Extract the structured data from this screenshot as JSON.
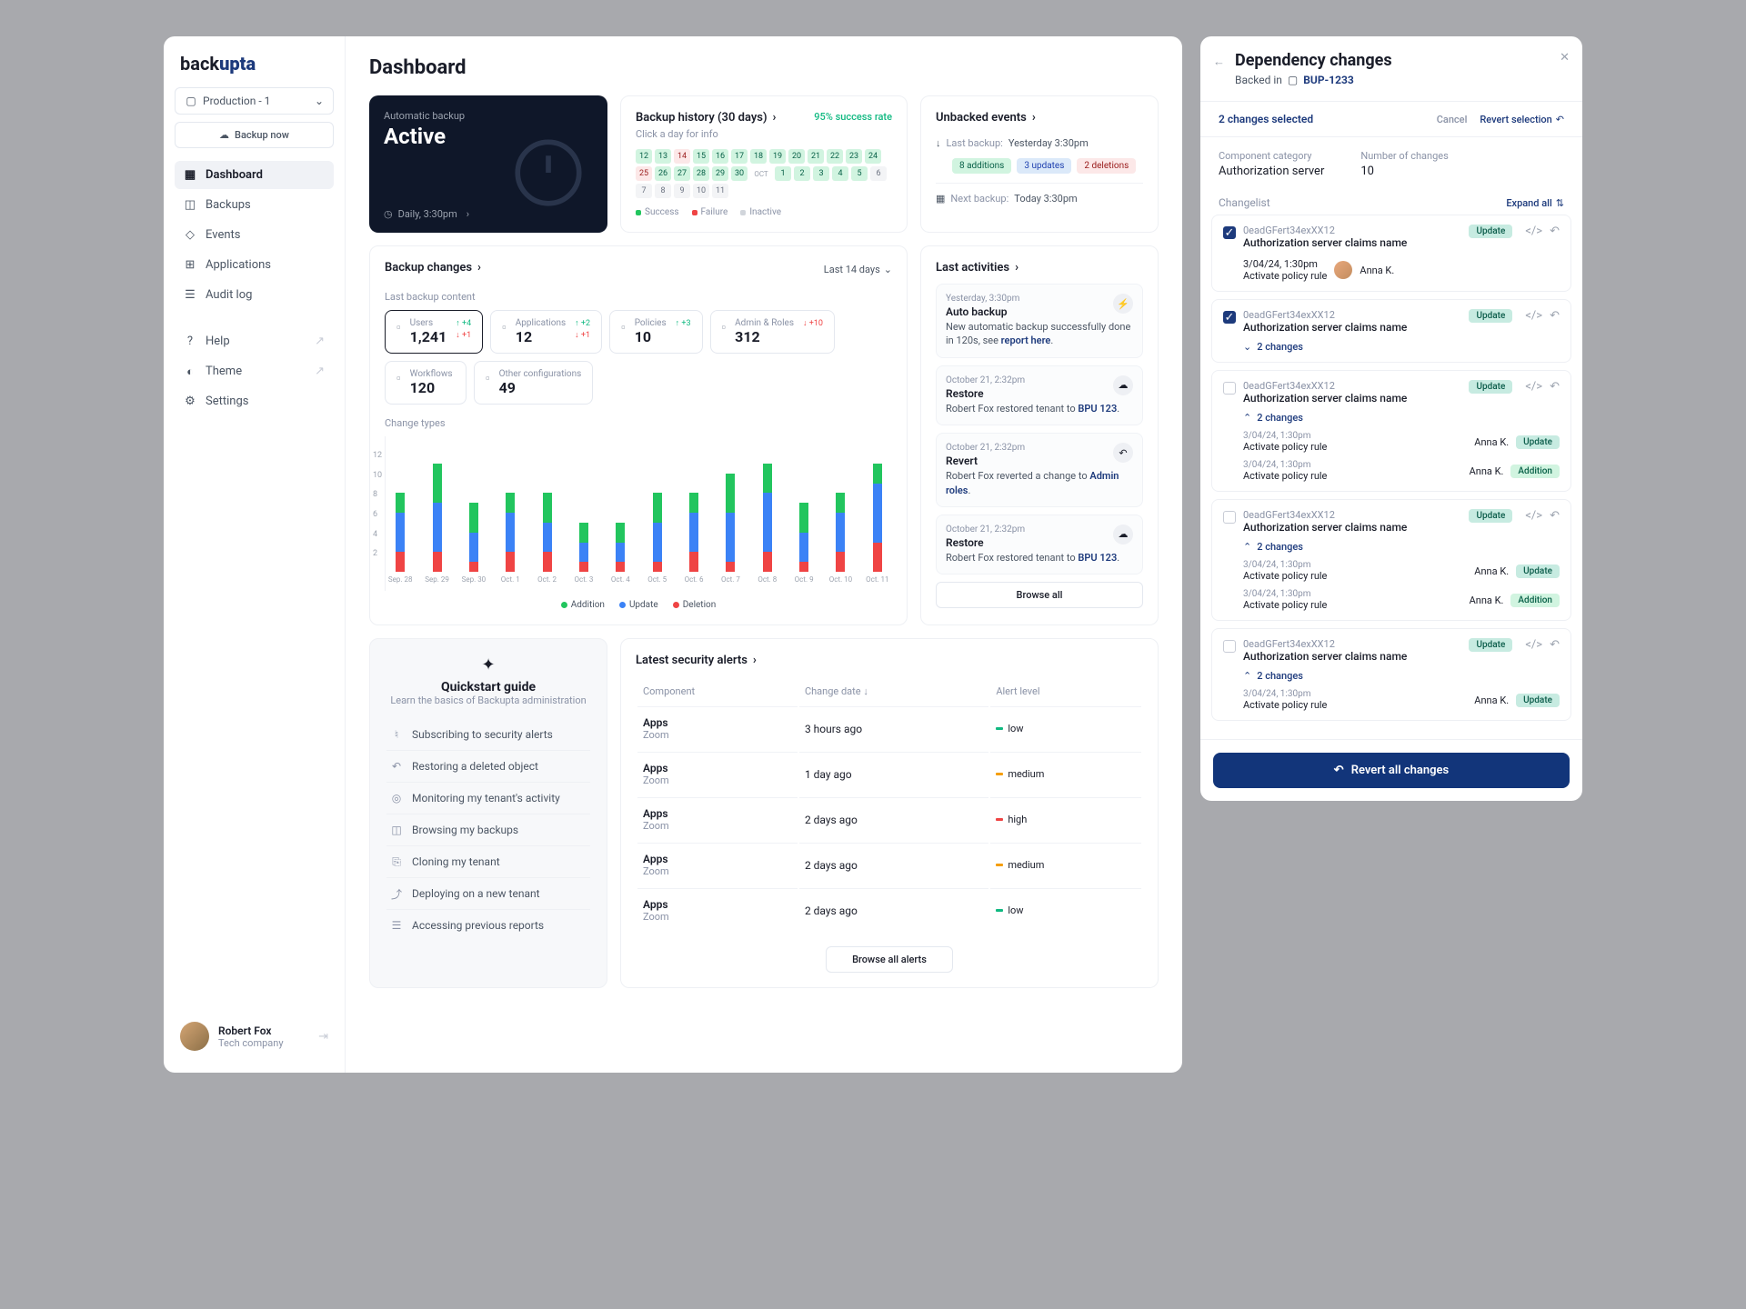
{
  "logo": {
    "pre": "back",
    "bold": "upta"
  },
  "env": "Production - 1",
  "backup_now": "Backup now",
  "nav": [
    {
      "label": "Dashboard",
      "active": true
    },
    {
      "label": "Backups"
    },
    {
      "label": "Events"
    },
    {
      "label": "Applications"
    },
    {
      "label": "Audit log"
    }
  ],
  "nav2": [
    {
      "label": "Help",
      "ext": true
    },
    {
      "label": "Theme",
      "ext": true
    },
    {
      "label": "Settings"
    }
  ],
  "profile": {
    "name": "Robert Fox",
    "company": "Tech company"
  },
  "title": "Dashboard",
  "hero": {
    "sub": "Automatic backup",
    "title": "Active",
    "footer": "Daily, 3:30pm"
  },
  "history": {
    "title": "Backup history (30 days)",
    "sub": "Click a day for info",
    "rate": "95% success rate",
    "legend": {
      "success": "Success",
      "failure": "Failure",
      "inactive": "Inactive"
    }
  },
  "calendar": [
    {
      "d": "12",
      "c": "g"
    },
    {
      "d": "13",
      "c": "g"
    },
    {
      "d": "14",
      "c": "r"
    },
    {
      "d": "15",
      "c": "g"
    },
    {
      "d": "16",
      "c": "g"
    },
    {
      "d": "17",
      "c": "g"
    },
    {
      "d": "18",
      "c": "g"
    },
    {
      "d": "19",
      "c": "g"
    },
    {
      "d": "20",
      "c": "g"
    },
    {
      "d": "21",
      "c": "g"
    },
    {
      "d": "22",
      "c": "g"
    },
    {
      "d": "23",
      "c": "g"
    },
    {
      "d": "24",
      "c": "g"
    },
    {
      "d": "25",
      "c": "r"
    },
    {
      "d": "26",
      "c": "g"
    },
    {
      "d": "27",
      "c": "g"
    },
    {
      "d": "28",
      "c": "g"
    },
    {
      "d": "29",
      "c": "g"
    },
    {
      "d": "30",
      "c": "g"
    },
    {
      "d": "OCT",
      "c": "m"
    },
    {
      "d": "1",
      "c": "g"
    },
    {
      "d": "2",
      "c": "g"
    },
    {
      "d": "3",
      "c": "g"
    },
    {
      "d": "4",
      "c": "g"
    },
    {
      "d": "5",
      "c": "g"
    },
    {
      "d": "6",
      "c": "i"
    },
    {
      "d": "7",
      "c": "i"
    },
    {
      "d": "8",
      "c": "i"
    },
    {
      "d": "9",
      "c": "i"
    },
    {
      "d": "10",
      "c": "i"
    },
    {
      "d": "11",
      "c": "i"
    }
  ],
  "unbacked": {
    "title": "Unbacked events",
    "last_label": "Last backup:",
    "last_val": "Yesterday 3:30pm",
    "next_label": "Next backup:",
    "next_val": "Today 3:30pm",
    "pills": [
      "8 additions",
      "3 updates",
      "2 deletions"
    ]
  },
  "changes": {
    "title": "Backup changes",
    "range": "Last 14 days",
    "section": "Last backup content",
    "ct": "Change types"
  },
  "metrics": [
    {
      "label": "Users",
      "value": "1,241",
      "up": "+4",
      "down": "+1",
      "active": true
    },
    {
      "label": "Applications",
      "value": "12",
      "up": "+2",
      "down": "+1"
    },
    {
      "label": "Policies",
      "value": "10",
      "up": "+3",
      "down": ""
    },
    {
      "label": "Admin & Roles",
      "value": "312",
      "up": "",
      "down": "+10"
    },
    {
      "label": "Workflows",
      "value": "120"
    },
    {
      "label": "Other configurations",
      "value": "49"
    }
  ],
  "chart_data": {
    "type": "bar",
    "title": "Change types",
    "ylabel": "",
    "xlabel": "",
    "ylim": [
      0,
      12
    ],
    "categories": [
      "Sep. 28",
      "Sep. 29",
      "Sep. 30",
      "Oct. 1",
      "Oct. 2",
      "Oct. 3",
      "Oct. 4",
      "Oct. 5",
      "Oct. 6",
      "Oct. 7",
      "Oct. 8",
      "Oct. 9",
      "Oct. 10",
      "Oct. 11"
    ],
    "series": [
      {
        "name": "Addition",
        "values": [
          2,
          4,
          3,
          2,
          3,
          2,
          2,
          3,
          2,
          4,
          3,
          3,
          2,
          2
        ]
      },
      {
        "name": "Update",
        "values": [
          4,
          5,
          3,
          4,
          3,
          2,
          2,
          4,
          4,
          5,
          6,
          3,
          4,
          6
        ]
      },
      {
        "name": "Deletion",
        "values": [
          2,
          2,
          1,
          2,
          2,
          1,
          1,
          1,
          2,
          1,
          2,
          1,
          2,
          3
        ]
      }
    ],
    "legend": [
      "Addition",
      "Update",
      "Deletion"
    ]
  },
  "activities": {
    "title": "Last activities",
    "browse": "Browse all",
    "items": [
      {
        "ts": "Yesterday, 3:30pm",
        "title": "Auto backup",
        "desc": "New automatic backup successfully done in 120s, see ",
        "link": "report here",
        "icon": "lightning"
      },
      {
        "ts": "October 21, 2:32pm",
        "title": "Restore",
        "desc": "Robert Fox restored tenant to ",
        "link": "BPU 123",
        "icon": "cloud"
      },
      {
        "ts": "October 21, 2:32pm",
        "title": "Revert",
        "desc": "Robert Fox reverted a change to ",
        "link": "Admin roles",
        "icon": "undo"
      },
      {
        "ts": "October 21, 2:32pm",
        "title": "Restore",
        "desc": "Robert Fox restored tenant to ",
        "link": "BPU 123",
        "icon": "cloud"
      }
    ]
  },
  "quickstart": {
    "title": "Quickstart guide",
    "sub": "Learn the basics of Backupta administration",
    "links": [
      "Subscribing to security alerts",
      "Restoring a deleted object",
      "Monitoring my tenant's activity",
      "Browsing my backups",
      "Cloning my tenant",
      "Deploying on a new tenant",
      "Accessing previous reports"
    ]
  },
  "alerts": {
    "title": "Latest security alerts",
    "browse": "Browse all alerts",
    "cols": [
      "Component",
      "Change date",
      "Alert level"
    ],
    "rows": [
      {
        "name": "Apps",
        "sub": "Zoom",
        "date": "3 hours ago",
        "level": "low",
        "color": "#10b981"
      },
      {
        "name": "Apps",
        "sub": "Zoom",
        "date": "1 day ago",
        "level": "medium",
        "color": "#f59e0b"
      },
      {
        "name": "Apps",
        "sub": "Zoom",
        "date": "2 days ago",
        "level": "high",
        "color": "#ef4444"
      },
      {
        "name": "Apps",
        "sub": "Zoom",
        "date": "2 days ago",
        "level": "medium",
        "color": "#f59e0b"
      },
      {
        "name": "Apps",
        "sub": "Zoom",
        "date": "2 days ago",
        "level": "low",
        "color": "#10b981"
      }
    ]
  },
  "panel": {
    "title": "Dependency changes",
    "backed": "Backed in",
    "bup": "BUP-1233",
    "selected": "2 changes selected",
    "cancel": "Cancel",
    "revert_sel": "Revert selection",
    "cat_label": "Component category",
    "cat_val": "Authorization server",
    "num_label": "Number of changes",
    "num_val": "10",
    "list_label": "Changelist",
    "expand": "Expand all",
    "revert_all": "Revert all changes",
    "items": [
      {
        "id": "0eadGFert34exXX12",
        "name": "Authorization server claims name",
        "checked": true,
        "tag": "Update",
        "single": {
          "ts": "3/04/24, 1:30pm",
          "desc": "Activate policy rule",
          "who": "Anna K."
        }
      },
      {
        "id": "0eadGFert34exXX12",
        "name": "Authorization server claims name",
        "checked": true,
        "tag": "Update",
        "collapsed": "2 changes",
        "multi_av": true
      },
      {
        "id": "0eadGFert34exXX12",
        "name": "Authorization server claims name",
        "tag": "Update",
        "expanded": "2 changes",
        "sub": [
          {
            "ts": "3/04/24, 1:30pm",
            "desc": "Activate policy rule",
            "who": "Anna K.",
            "tag": "Update"
          },
          {
            "ts": "3/04/24, 1:30pm",
            "desc": "Activate policy rule",
            "who": "Anna K.",
            "tag": "Addition"
          }
        ]
      },
      {
        "id": "0eadGFert34exXX12",
        "name": "Authorization server claims name",
        "tag": "Update",
        "expanded": "2 changes",
        "sub": [
          {
            "ts": "3/04/24, 1:30pm",
            "desc": "Activate policy rule",
            "who": "Anna K.",
            "tag": "Update"
          },
          {
            "ts": "3/04/24, 1:30pm",
            "desc": "Activate policy rule",
            "who": "Anna K.",
            "tag": "Addition"
          }
        ]
      },
      {
        "id": "0eadGFert34exXX12",
        "name": "Authorization server claims name",
        "tag": "Update",
        "expanded": "2 changes",
        "sub": [
          {
            "ts": "3/04/24, 1:30pm",
            "desc": "Activate policy rule",
            "who": "Anna K.",
            "tag": "Update"
          }
        ]
      }
    ]
  }
}
